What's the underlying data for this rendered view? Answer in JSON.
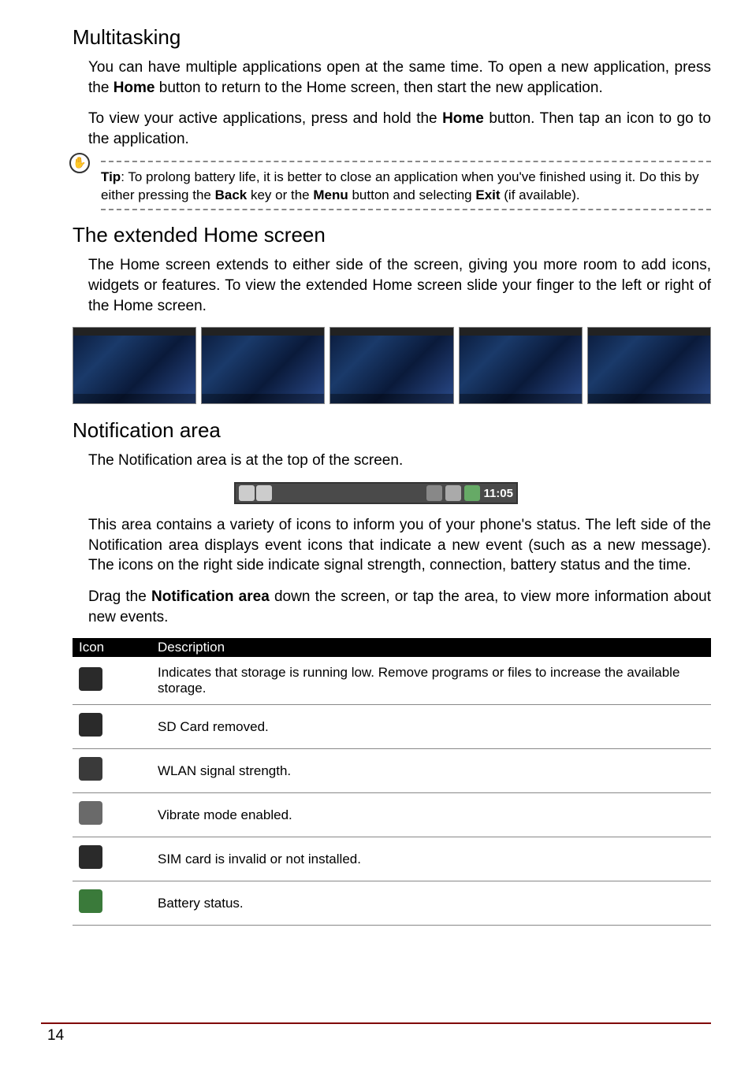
{
  "sections": {
    "multitasking": {
      "title": "Multitasking",
      "p1a": "You can have multiple applications open at the same time. To open a new application, press the ",
      "p1b": "Home",
      "p1c": " button to return to the Home screen, then start the new application.",
      "p2a": "To view your active applications, press and hold the ",
      "p2b": "Home",
      "p2c": " button. Then tap an icon to go to the application.",
      "tip_label": "Tip",
      "tip_a": ": To prolong battery life, it is better to close an application when you've finished using it. Do this by either pressing the ",
      "tip_b": "Back",
      "tip_c": " key or the ",
      "tip_d": "Menu",
      "tip_e": " button and selecting ",
      "tip_f": "Exit",
      "tip_g": " (if available)."
    },
    "extended": {
      "title": "The extended Home screen",
      "p1": "The Home screen extends to either side of the screen, giving you more room to add icons, widgets or features. To view the extended Home screen slide your finger to the left or right of the Home screen."
    },
    "notification": {
      "title": "Notification area",
      "p1": "The Notification area is at the top of the screen.",
      "bar_time": "11:05",
      "p2": "This area contains a variety of icons to inform you of your phone's status. The left side of the Notification area displays event icons that indicate a new event (such as a new message). The icons on the right side indicate signal strength, connection, battery status and the time.",
      "p3a": "Drag the ",
      "p3b": "Notification area",
      "p3c": " down the screen, or tap the area, to view more information about new events."
    }
  },
  "table": {
    "header_icon": "Icon",
    "header_desc": "Description",
    "rows": [
      {
        "name": "storage-low-icon",
        "color": "#2a2a2a",
        "desc": "Indicates that storage is running low. Remove programs or files to increase the available storage."
      },
      {
        "name": "sd-removed-icon",
        "color": "#2a2a2a",
        "desc": "SD Card removed."
      },
      {
        "name": "wlan-icon",
        "color": "#3a3a3a",
        "desc": "WLAN signal strength."
      },
      {
        "name": "vibrate-icon",
        "color": "#6a6a6a",
        "desc": "Vibrate mode enabled."
      },
      {
        "name": "sim-invalid-icon",
        "color": "#2a2a2a",
        "desc": "SIM card is invalid or not installed."
      },
      {
        "name": "battery-icon",
        "color": "#3a7a3a",
        "desc": "Battery status."
      }
    ]
  },
  "page_number": "14"
}
